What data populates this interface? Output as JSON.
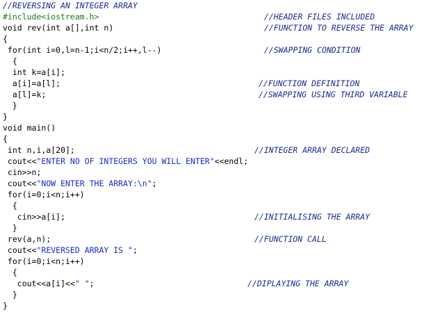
{
  "colors": {
    "background": "#ffffff",
    "code": "#000000",
    "comment": "#1a2b8c",
    "string": "#1a2bbf",
    "preprocessor": "#1a7a1a"
  },
  "lines": [
    {
      "code": "",
      "comment": "//REVERSING AN INTEGER ARRAY"
    },
    {
      "code": "#include<iostream.h>",
      "comment": "//HEADER FILES INCLUDED"
    },
    {
      "code": "void rev(int a[],int n)",
      "comment": "//FUNCTION TO REVERSE THE ARRAY"
    },
    {
      "code": "{",
      "comment": ""
    },
    {
      "code": " for(int i=0,l=n-1;i<n/2;i++,l--)",
      "comment": "//SWAPPING CONDITION"
    },
    {
      "code": "  {",
      "comment": ""
    },
    {
      "code": "  int k=a[i];",
      "comment": ""
    },
    {
      "code": "  a[i]=a[l];",
      "comment": "//FUNCTION DEFINITION"
    },
    {
      "code": "  a[l]=k;",
      "comment": "//SWAPPING USING THIRD VARIABLE"
    },
    {
      "code": "  }",
      "comment": ""
    },
    {
      "code": "}",
      "comment": ""
    },
    {
      "code": "void main()",
      "comment": ""
    },
    {
      "code": "{",
      "comment": ""
    },
    {
      "code": " int n,i,a[20];",
      "comment": "//INTEGER ARRAY DECLARED"
    },
    {
      "code": " cout<<\"ENTER NO OF INTEGERS YOU WILL ENTER\"<<endl;",
      "comment": ""
    },
    {
      "code": " cin>>n;",
      "comment": ""
    },
    {
      "code": " cout<<\"NOW ENTER THE ARRAY:\\n\";",
      "comment": ""
    },
    {
      "code": " for(i=0;i<n;i++)",
      "comment": ""
    },
    {
      "code": "  {",
      "comment": ""
    },
    {
      "code": "   cin>>a[i];",
      "comment": "//INITIALISING THE ARRAY"
    },
    {
      "code": "  }",
      "comment": ""
    },
    {
      "code": " rev(a,n);",
      "comment": "//FUNCTION CALL"
    },
    {
      "code": " cout<<\"REVERSED ARRAY IS \";",
      "comment": ""
    },
    {
      "code": " for(i=0;i<n;i++)",
      "comment": ""
    },
    {
      "code": "  {",
      "comment": ""
    },
    {
      "code": "   cout<<a[i]<<\" \";",
      "comment": "//DIPLAYING THE ARRAY"
    },
    {
      "code": "  }",
      "comment": ""
    },
    {
      "code": "}",
      "comment": ""
    }
  ]
}
